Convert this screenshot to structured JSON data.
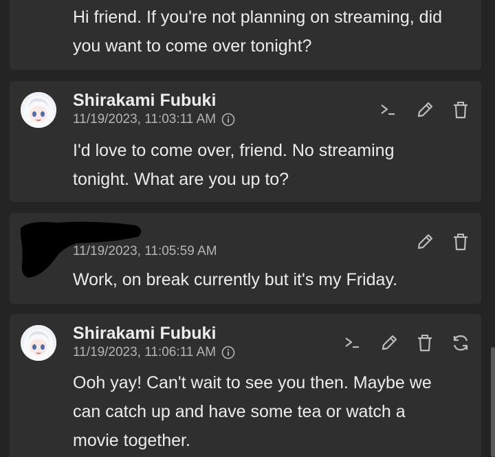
{
  "colors": {
    "background": "#242424",
    "card": "#2f2f2f",
    "text": "#ececec",
    "muted": "#b5b5b5",
    "icon": "#bdbdbd"
  },
  "messages": [
    {
      "author": "",
      "timestamp": "",
      "text": "Hi friend. If you're not planning on streaming, did you want to come over tonight?"
    },
    {
      "author": "Shirakami Fubuki",
      "timestamp": "11/19/2023, 11:03:11 AM",
      "text": "I'd love to come over, friend. No streaming tonight. What are you up to?",
      "icons": [
        "terminal-icon",
        "edit-icon",
        "delete-icon"
      ]
    },
    {
      "author": "",
      "timestamp": "11/19/2023, 11:05:59 AM",
      "text": "Work, on break currently but it's my Friday.",
      "icons": [
        "edit-icon",
        "delete-icon"
      ]
    },
    {
      "author": "Shirakami Fubuki",
      "timestamp": "11/19/2023, 11:06:11 AM",
      "text": "Ooh yay! Can't wait to see you then. Maybe we can catch up and have some tea or watch a movie together.",
      "icons": [
        "terminal-icon",
        "edit-icon",
        "delete-icon",
        "regenerate-icon"
      ]
    }
  ]
}
